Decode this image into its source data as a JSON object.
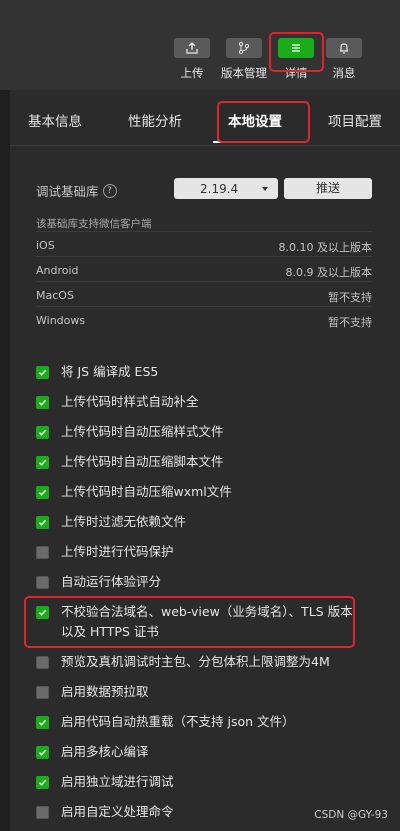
{
  "toolbar": {
    "buttons": [
      {
        "label": "上传",
        "icon": "upload-icon"
      },
      {
        "label": "版本管理",
        "icon": "branch-icon"
      },
      {
        "label": "详情",
        "icon": "menu-icon"
      },
      {
        "label": "消息",
        "icon": "bell-icon"
      }
    ],
    "active_color": "#1aad19"
  },
  "tabs": [
    "基本信息",
    "性能分析",
    "本地设置",
    "项目配置"
  ],
  "active_tab": "本地设置",
  "base_library": {
    "label": "调试基础库",
    "help_icon": "?",
    "version": "2.19.4",
    "push_label": "推送",
    "support_note": "该基础库支持微信客户端",
    "platforms": [
      {
        "name": "iOS",
        "value": "8.0.10 及以上版本"
      },
      {
        "name": "Android",
        "value": "8.0.9 及以上版本"
      },
      {
        "name": "MacOS",
        "value": "暂不支持"
      },
      {
        "name": "Windows",
        "value": "暂不支持"
      }
    ]
  },
  "options": [
    {
      "label": "将 JS 编译成 ES5",
      "checked": true
    },
    {
      "label": "上传代码时样式自动补全",
      "checked": true
    },
    {
      "label": "上传代码时自动压缩样式文件",
      "checked": true
    },
    {
      "label": "上传代码时自动压缩脚本文件",
      "checked": true
    },
    {
      "label": "上传代码时自动压缩wxml文件",
      "checked": true
    },
    {
      "label": "上传时过滤无依赖文件",
      "checked": true
    },
    {
      "label": "上传时进行代码保护",
      "checked": false
    },
    {
      "label": "自动运行体验评分",
      "checked": false
    },
    {
      "label": "不校验合法域名、web-view（业务域名）、TLS 版本以及 HTTPS 证书",
      "checked": true
    },
    {
      "label": "预览及真机调试时主包、分包体积上限调整为4M",
      "checked": false
    },
    {
      "label": "启用数据预拉取",
      "checked": false
    },
    {
      "label": "启用代码自动热重载（不支持 json 文件）",
      "checked": true
    },
    {
      "label": "启用多核心编译",
      "checked": true
    },
    {
      "label": "启用独立域进行调试",
      "checked": true
    },
    {
      "label": "启用自定义处理命令",
      "checked": false
    }
  ],
  "watermark": "CSDN @GY-93",
  "highlight_color": "#e0242e"
}
